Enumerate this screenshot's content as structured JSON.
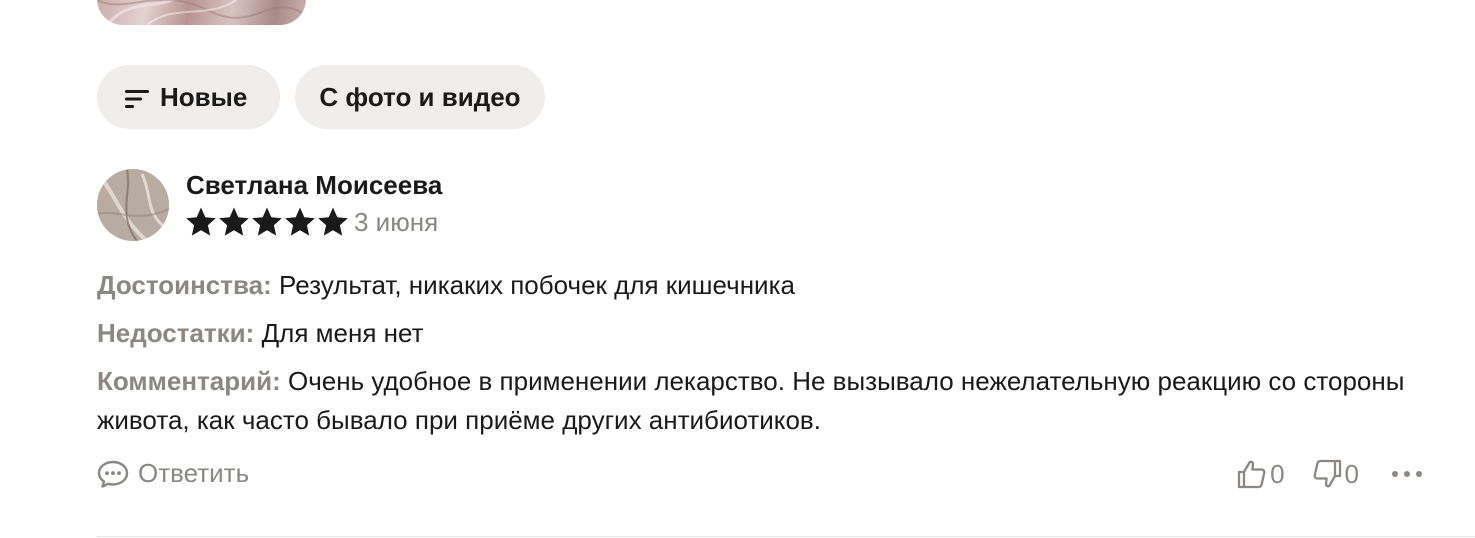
{
  "filters": {
    "sort_label": "Новые",
    "media_label": "С фото и видео"
  },
  "review": {
    "author": "Светлана Моисеева",
    "rating": 5,
    "rating_max": 5,
    "date": "3 июня",
    "pros_label": "Достоинства:",
    "pros_text": "Результат, никаких побочек для кишечника",
    "cons_label": "Недостатки:",
    "cons_text": "Для меня нет",
    "comment_label": "Комментарий:",
    "comment_text": "Очень удобное в применении лекарство. Не вызывало нежелательную реакцию со стороны живота, как часто бывало при приёме других антибиотиков."
  },
  "actions": {
    "reply_label": "Ответить",
    "likes": "0",
    "dislikes": "0"
  },
  "icons": {
    "sort": "sort-lines-icon",
    "star": "star-icon",
    "reply": "chat-bubble-icon",
    "like": "thumbs-up-icon",
    "dislike": "thumbs-down-icon",
    "more": "more-horizontal-icon"
  },
  "colors": {
    "chip_bg": "#efeeec",
    "text_primary": "#1a1a1a",
    "text_secondary": "#8a8784",
    "star": "#1a1a1a"
  }
}
